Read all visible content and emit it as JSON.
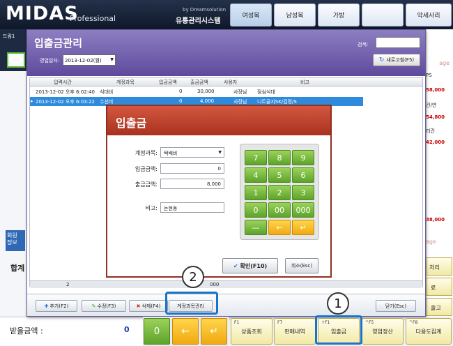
{
  "app": {
    "logo": "MIDAS",
    "logo_sub": "Professional",
    "brand_small": "by Dreamsolution",
    "brand_name": "유통관리시스템"
  },
  "categories": [
    "여성복",
    "남성복",
    "가방",
    "",
    "악세사리"
  ],
  "left_fragments": {
    "top_text": "드림1",
    "member_tab": "회원 정보",
    "total_label": "합계",
    "received_label": "받을금액 :",
    "received_value": "0"
  },
  "right_fragments": [
    "PS",
    "58,000",
    "건/연",
    "54,800",
    "리건",
    "42,000",
    "38,000",
    "age",
    "age",
    "처리",
    "료",
    "출고"
  ],
  "dialog": {
    "title": "입출금관리",
    "date_label": "영업일자:",
    "date_value": "2013-12-02(월)",
    "search_label": "검색:",
    "refresh_label": "새로고침(F5)",
    "columns": [
      "입력시간",
      "계정과목",
      "입금금액",
      "출금금액",
      "사용자",
      "비고"
    ],
    "rows": [
      {
        "time": "2013-12-02 오후 6:02:40",
        "account": "식대비",
        "in": "0",
        "out": "30,000",
        "user": "사장님",
        "note": "점심식대"
      },
      {
        "time": "2013-12-02 오후 6:03:22",
        "account": "수선비",
        "in": "0",
        "out": "4,000",
        "user": "사장님",
        "note": "니트골지SK/검정/S"
      }
    ],
    "footer_count": "2",
    "footer_value": "000",
    "buttons": {
      "add": "추가(F2)",
      "edit": "수정(F3)",
      "delete": "삭제(F4)",
      "account": "계정과목관리",
      "close": "닫기(Esc)"
    }
  },
  "popup": {
    "title": "입출금",
    "fields": [
      {
        "label": "계정과목:",
        "value": "택배비"
      },
      {
        "label": "입금금액:",
        "value": "0"
      },
      {
        "label": "출금금액:",
        "value": "8,000"
      },
      {
        "label": "비고:",
        "value": "논현동"
      }
    ],
    "keys": [
      "7",
      "8",
      "9",
      "4",
      "5",
      "6",
      "1",
      "2",
      "3",
      "0",
      "00",
      "000",
      "—",
      "←",
      "↵"
    ],
    "ok_label": "확인(F10)",
    "cancel_label": "취소(Esc)"
  },
  "bottom_keys": {
    "k0": "0",
    "back": "←",
    "enter": "↵",
    "fkeys": [
      {
        "hint": "F1",
        "label": "상품조회"
      },
      {
        "hint": "F7",
        "label": "판매내역"
      },
      {
        "hint": "↑F1",
        "label": "입출금"
      },
      {
        "hint": "^F5",
        "label": "영업정산"
      },
      {
        "hint": "^F8",
        "label": "다용도집계"
      }
    ]
  },
  "callouts": [
    "1",
    "2"
  ]
}
